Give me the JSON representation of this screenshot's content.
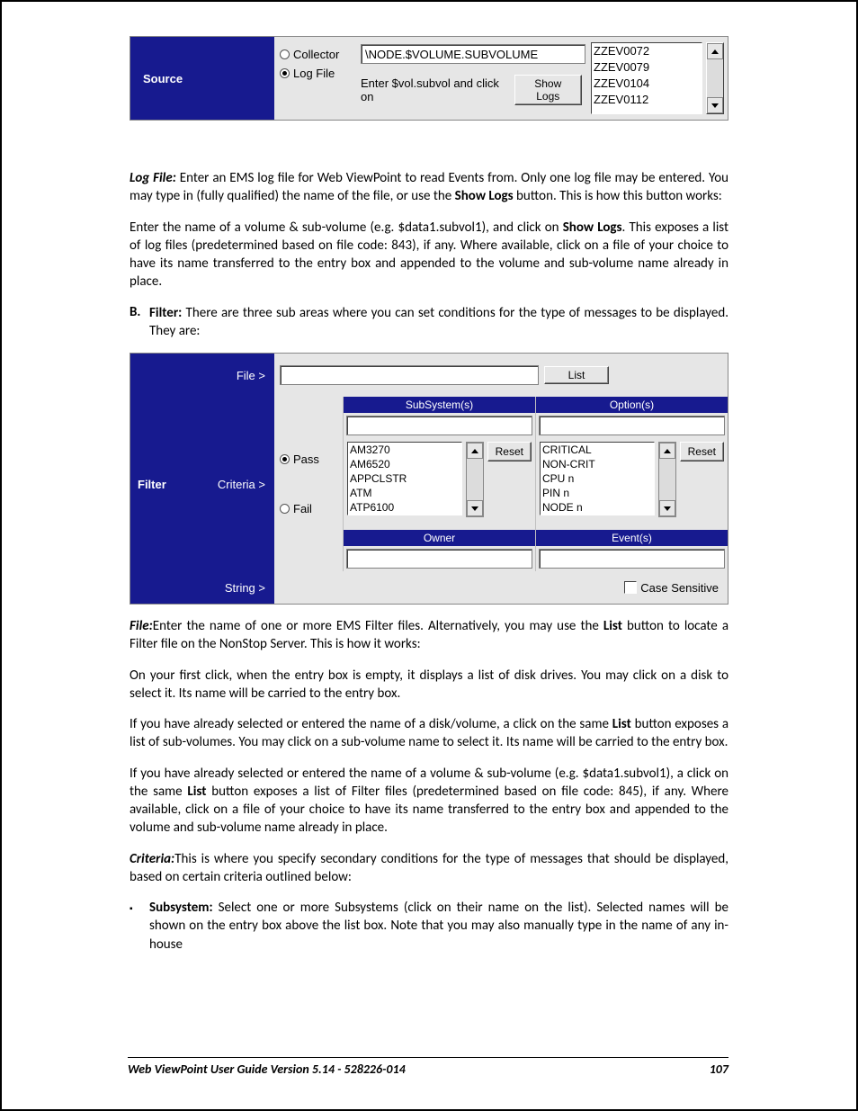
{
  "source_panel": {
    "title": "Source",
    "radio_collector": "Collector",
    "radio_logfile": "Log File",
    "input_value": "\\NODE.$VOLUME.SUBVOLUME",
    "hint_prefix": "Enter $vol.subvol and click on",
    "show_logs_btn": "Show Logs",
    "list": [
      "ZZEV0072",
      "ZZEV0079",
      "ZZEV0104",
      "ZZEV0112"
    ]
  },
  "para_logfile_label": "Log File:",
  "para_logfile_1a": " Enter an EMS log file for Web ViewPoint to read Events from.  Only one log file may be entered.  You may type in (fully qualified) the name of the file, or use the ",
  "para_logfile_bold": "Show Logs",
  "para_logfile_1b": " button.  This is how this button works:",
  "para_logfile_2a": "Enter the name of a volume & sub-volume (e.g. $data1.subvol1), and click on ",
  "para_logfile_2bold": "Show Logs",
  "para_logfile_2b": ". This exposes a list of log files (predetermined based on file code: 843), if any.  Where available, click on a file of your choice to have its name transferred to the entry box and appended to the volume and sub-volume name already in place.",
  "section_b_letter": "B.",
  "section_b_label": "Filter:",
  "section_b_text": " There are three sub areas where you can set conditions for the type of messages to be displayed.  They are:",
  "filter_panel": {
    "left_title": "Filter",
    "row_file": "File  >",
    "row_criteria": "Criteria  >",
    "row_string": "String  >",
    "list_btn": "List",
    "pass": "Pass",
    "fail": "Fail",
    "hdr_subsystems": "SubSystem(s)",
    "hdr_options": "Option(s)",
    "hdr_owner": "Owner",
    "hdr_events": "Event(s)",
    "reset_btn": "Reset",
    "subsystems": [
      "AM3270",
      "AM6520",
      "APPCLSTR",
      "ATM",
      "ATP6100"
    ],
    "options": [
      "CRITICAL",
      "NON-CRIT",
      "CPU n",
      "PIN n",
      "NODE n"
    ],
    "case_sensitive": "Case Sensitive"
  },
  "para_file_label": "File:",
  "para_file_1a": "Enter the name of one or more EMS Filter files.  Alternatively, you may use the ",
  "para_file_bold": "List",
  "para_file_1b": " button to locate a Filter file on the NonStop Server.  This is how it works:",
  "para_file_2": "On your first click, when the entry box is empty, it displays a list of disk drives.  You may click on a disk to select it.  Its name will be carried to the entry box.",
  "para_file_3a": "If you have already selected or entered the name of a disk/volume, a click on the same ",
  "para_file_3bold": "List",
  "para_file_3b": " button exposes a list of sub-volumes.  You may click on a sub-volume name to select it.  Its name will be carried to the entry box.",
  "para_file_4a": "If you have already selected or entered the name of a volume & sub-volume (e.g. $data1.subvol1), a click on the same ",
  "para_file_4bold": "List",
  "para_file_4b": " button exposes a list of Filter files (predetermined based on file code: 845), if any.  Where available, click on a file of your choice to have its name transferred to the entry box and appended to the volume and sub-volume name already in place.",
  "para_criteria_label": "Criteria:",
  "para_criteria_text": "This is where you specify secondary conditions for the type of messages that should be displayed, based on certain criteria outlined below:",
  "bullet_sub_label": "Subsystem:",
  "bullet_sub_text": " Select one or more Subsystems (click on their name on the list).  Selected names will be shown on the entry box above the list box.  Note that you may also manually type in the name of any in-house",
  "footer_left": "Web ViewPoint User Guide Version 5.14 - 528226-014",
  "footer_right": "107"
}
